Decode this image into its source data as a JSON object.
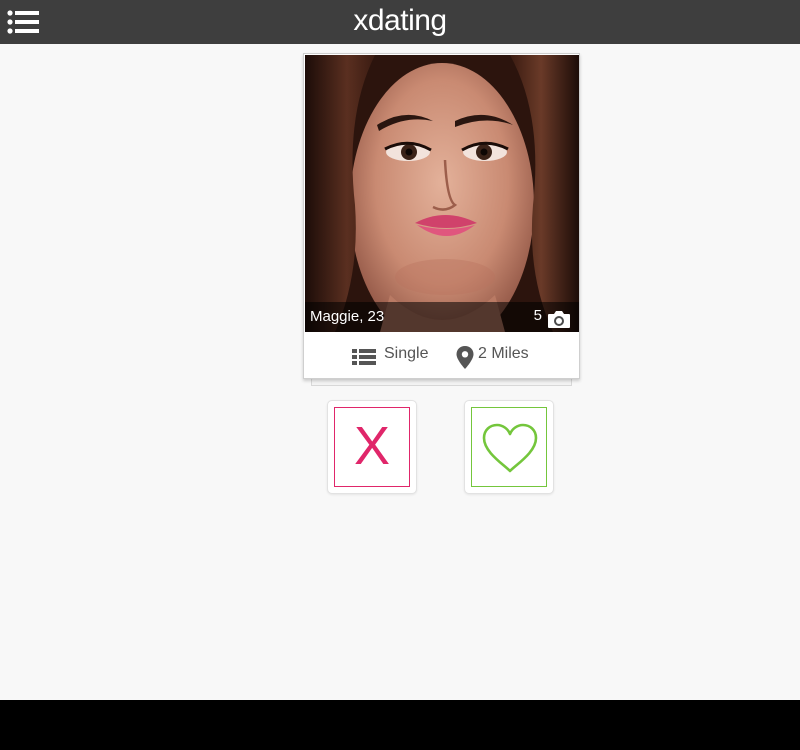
{
  "header": {
    "title": "xdating"
  },
  "profile": {
    "name_age": "Maggie, 23",
    "photo_count": "5",
    "relationship_status": "Single",
    "distance": "2 Miles"
  },
  "icons": {
    "menu": "menu-list-icon",
    "camera": "camera-icon",
    "status": "list-icon",
    "location": "map-pin-icon",
    "reject": "x-icon",
    "like": "heart-icon"
  },
  "actions": {
    "reject_label": "X"
  },
  "colors": {
    "header_bg": "#3e3e3e",
    "page_bg": "#f8f8f8",
    "reject": "#e0266a",
    "like": "#74c63c"
  }
}
